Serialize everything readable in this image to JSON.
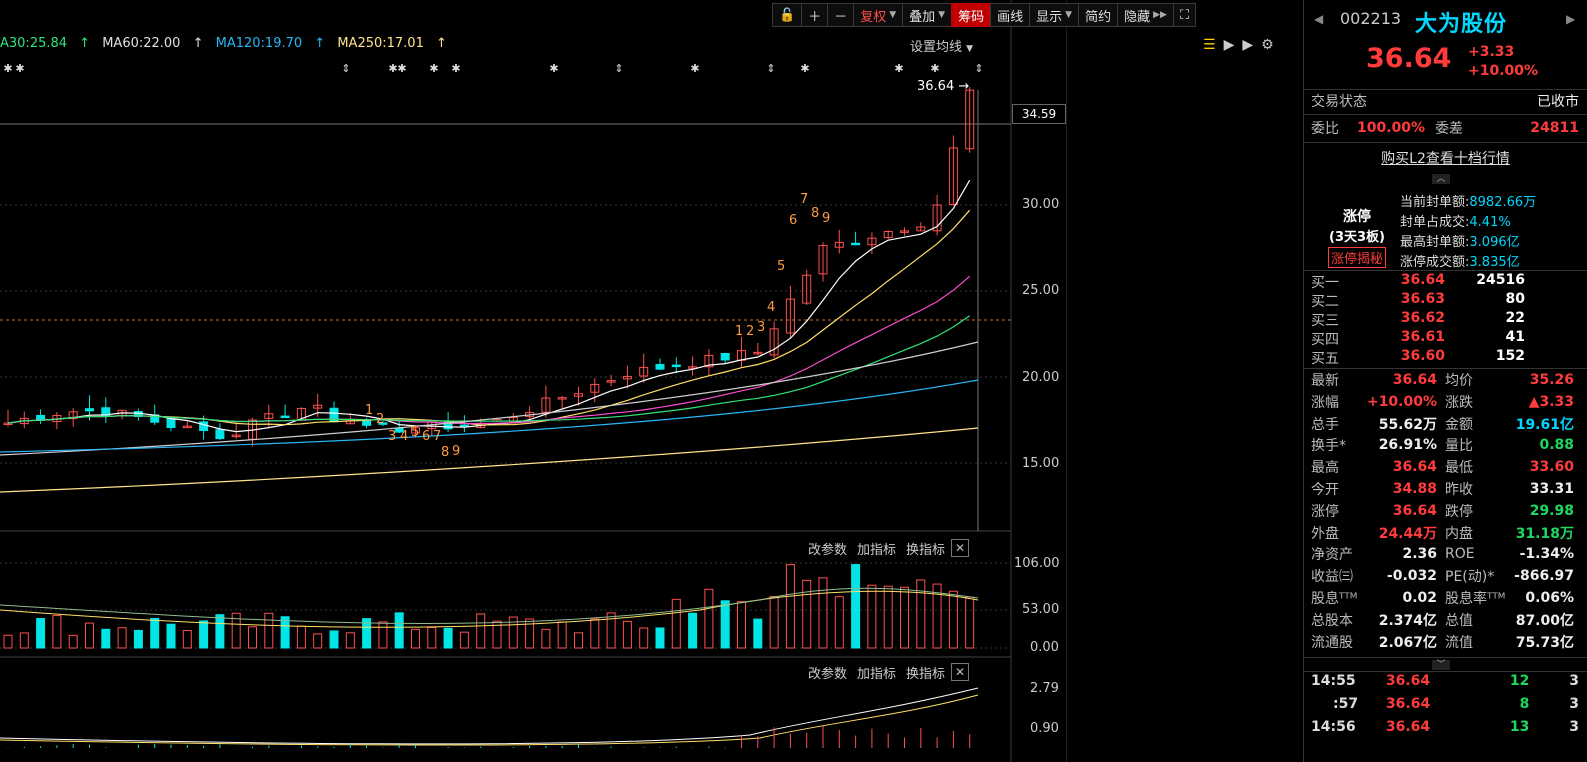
{
  "toolbar": {
    "buttons": [
      "复权",
      "叠加",
      "筹码",
      "画线",
      "显示",
      "简约",
      "隐藏"
    ]
  },
  "ma_legend": [
    {
      "text": "A30:25.84",
      "color": "#2ee57a"
    },
    {
      "text": "MA60:22.00",
      "color": "#e0e0e0"
    },
    {
      "text": "MA120:19.70",
      "color": "#29b6f6"
    },
    {
      "text": "MA250:17.01",
      "color": "#ffe38a"
    }
  ],
  "ma_setting": "设置均线",
  "chart": {
    "high_label": "36.64",
    "cursor_price": "34.59",
    "price_axis": [
      "30.00",
      "25.00",
      "20.00",
      "15.00"
    ],
    "volume_axis": [
      "106.00",
      "53.00",
      "0.00"
    ],
    "indicator_axis": [
      "2.79",
      "0.90"
    ],
    "panel_buttons": [
      "改参数",
      "加指标",
      "换指标"
    ],
    "td_top_seq": [
      "4",
      "5",
      "6",
      "7",
      "8",
      "9"
    ],
    "td_mid_seq": [
      "1",
      "2",
      "3"
    ],
    "td_low_seq": [
      "1",
      "2",
      "3",
      "4",
      "5",
      "6",
      "7",
      "8",
      "9"
    ]
  },
  "stock": {
    "code": "002213",
    "name": "大为股份",
    "price": "36.64",
    "change": "+3.33",
    "change_pct": "+10.00%"
  },
  "status": {
    "label": "交易状态",
    "value": "已收市",
    "wb_label": "委比",
    "wb_value": "100.00%",
    "wc_label": "委差",
    "wc_value": "24811"
  },
  "l2_link": "购买L2查看十档行情",
  "limit_up": {
    "title": "涨停",
    "sub": "(3天3板)",
    "tag": "涨停揭秘",
    "info": [
      {
        "k": "当前封单额:",
        "v": "8982.66万"
      },
      {
        "k": "封单占成交:",
        "v": "4.41%"
      },
      {
        "k": "最高封单额:",
        "v": "3.096亿"
      },
      {
        "k": "涨停成交额:",
        "v": "3.835亿"
      }
    ]
  },
  "bids": [
    {
      "label": "买一",
      "price": "36.64",
      "vol": "24516"
    },
    {
      "label": "买二",
      "price": "36.63",
      "vol": "80"
    },
    {
      "label": "买三",
      "price": "36.62",
      "vol": "22"
    },
    {
      "label": "买四",
      "price": "36.61",
      "vol": "41"
    },
    {
      "label": "买五",
      "price": "36.60",
      "vol": "152"
    }
  ],
  "stats": [
    {
      "k1": "最新",
      "v1": "36.64",
      "c1": "red",
      "k2": "均价",
      "v2": "35.26",
      "c2": "red"
    },
    {
      "k1": "涨幅",
      "v1": "+10.00%",
      "c1": "red",
      "k2": "涨跌",
      "v2": "▲3.33",
      "c2": "red"
    },
    {
      "k1": "总手",
      "v1": "55.62万",
      "c1": "wht",
      "k2": "金额",
      "v2": "19.61亿",
      "c2": "cyan"
    },
    {
      "k1": "换手*",
      "v1": "26.91%",
      "c1": "wht",
      "k2": "量比",
      "v2": "0.88",
      "c2": "grn"
    },
    {
      "k1": "最高",
      "v1": "36.64",
      "c1": "red",
      "k2": "最低",
      "v2": "33.60",
      "c2": "red"
    },
    {
      "k1": "今开",
      "v1": "34.88",
      "c1": "red",
      "k2": "昨收",
      "v2": "33.31",
      "c2": "wht"
    },
    {
      "k1": "涨停",
      "v1": "36.64",
      "c1": "red",
      "k2": "跌停",
      "v2": "29.98",
      "c2": "grn"
    },
    {
      "k1": "外盘",
      "v1": "24.44万",
      "c1": "red",
      "k2": "内盘",
      "v2": "31.18万",
      "c2": "grn"
    },
    {
      "k1": "净资产",
      "v1": "2.36",
      "c1": "wht",
      "k2": "ROE",
      "v2": "-1.34%",
      "c2": "wht"
    },
    {
      "k1": "收益㈢",
      "v1": "-0.032",
      "c1": "wht",
      "k2": "PE(动)*",
      "v2": "-866.97",
      "c2": "wht"
    },
    {
      "k1": "股息ᵀᵀᴹ",
      "v1": "0.02",
      "c1": "wht",
      "k2": "股息率ᵀᵀᴹ",
      "v2": "0.06%",
      "c2": "wht"
    },
    {
      "k1": "总股本",
      "v1": "2.374亿",
      "c1": "wht",
      "k2": "总值",
      "v2": "87.00亿",
      "c2": "wht"
    },
    {
      "k1": "流通股",
      "v1": "2.067亿",
      "c1": "wht",
      "k2": "流值",
      "v2": "75.73亿",
      "c2": "wht"
    }
  ],
  "ticks": [
    {
      "time": "14:55",
      "price": "36.64",
      "vol": "12",
      "n": "3"
    },
    {
      "time": ":57",
      "price": "36.64",
      "vol": "8",
      "n": "3"
    },
    {
      "time": "14:56",
      "price": "36.64",
      "vol": "13",
      "n": "3"
    }
  ]
}
